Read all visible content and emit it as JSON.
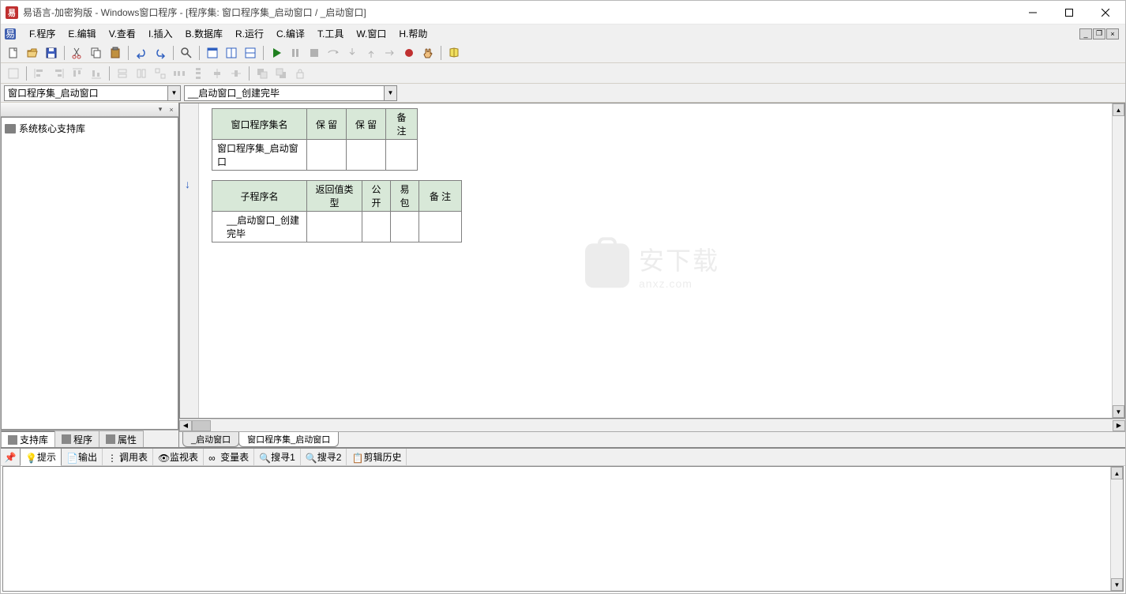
{
  "title": "易语言-加密狗版 - Windows窗口程序 - [程序集: 窗口程序集_启动窗口 / _启动窗口]",
  "menu": {
    "items": [
      "F.程序",
      "E.编辑",
      "V.查看",
      "I.插入",
      "B.数据库",
      "R.运行",
      "C.编译",
      "T.工具",
      "W.窗口",
      "H.帮助"
    ]
  },
  "dropdowns": {
    "d1": "窗口程序集_启动窗口",
    "d2": "__启动窗口_创建完毕"
  },
  "leftpanel": {
    "tree_item": "系统核心支持库",
    "tabs": [
      "支持库",
      "程序",
      "属性"
    ]
  },
  "editor": {
    "table1": {
      "headers": [
        "窗口程序集名",
        "保 留",
        "保 留",
        "备 注"
      ],
      "row": [
        "窗口程序集_启动窗口",
        "",
        "",
        ""
      ]
    },
    "table2": {
      "headers": [
        "子程序名",
        "返回值类型",
        "公开",
        "易包",
        "备 注"
      ],
      "row": [
        "__启动窗口_创建完毕",
        "",
        "",
        "",
        ""
      ]
    },
    "tabs": [
      "_启动窗口",
      "窗口程序集_启动窗口"
    ],
    "watermark": {
      "text": "安下载",
      "sub": "anxz.com"
    }
  },
  "bottom": {
    "tabs": [
      "提示",
      "输出",
      "调用表",
      "监视表",
      "变量表",
      "搜寻1",
      "搜寻2",
      "剪辑历史"
    ]
  }
}
